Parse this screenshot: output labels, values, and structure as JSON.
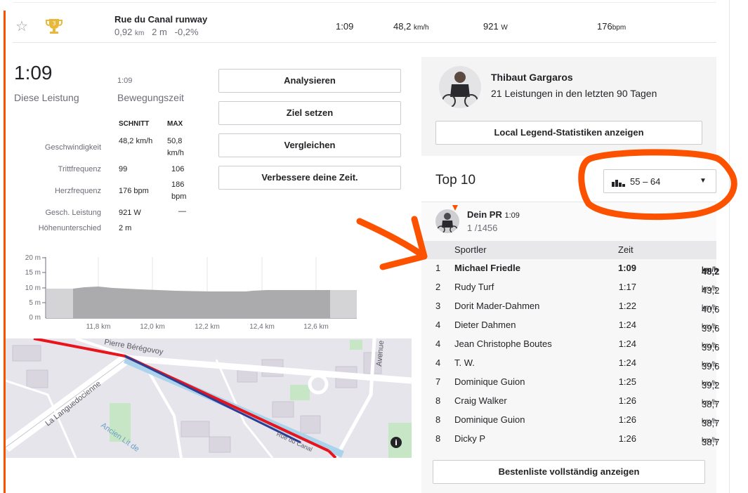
{
  "segment": {
    "name": "Rue du Canal runway",
    "distance": "0,92",
    "distance_unit": "km",
    "elev_gain": "2 m",
    "grade": "-0,2%",
    "time": "1:09",
    "speed": "48,2",
    "speed_unit": "km/h",
    "power": "921",
    "power_unit": "W",
    "hr": "176",
    "hr_unit": "bpm",
    "trophy_rank": "3"
  },
  "effort": {
    "time": "1:09",
    "time_label": "Diese Leistung",
    "moving_time": "1:09",
    "moving_label": "Bewegungszeit",
    "col_avg": "SCHNITT",
    "col_max": "MAX",
    "rows": [
      {
        "label": "Geschwindigkeit",
        "avg": "48,2 km/h",
        "max": "50,8 km/h"
      },
      {
        "label": "Trittfrequenz",
        "avg": "99",
        "max": "106"
      },
      {
        "label": "Herzfrequenz",
        "avg": "176 bpm",
        "max": "186 bpm"
      },
      {
        "label": "Gesch. Leistung",
        "avg": "921 W",
        "max": "—"
      },
      {
        "label": "Höhenunterschied",
        "avg": "2 m",
        "max": ""
      }
    ]
  },
  "actions": {
    "analyze": "Analysieren",
    "goal": "Ziel setzen",
    "compare": "Vergleichen",
    "improve": "Verbessere deine Zeit."
  },
  "elevation": {
    "y_ticks": [
      "20 m",
      "15 m",
      "10 m",
      "5 m",
      "0 m"
    ],
    "x_ticks": [
      "11,8 km",
      "12,0 km",
      "12,2 km",
      "12,4 km",
      "12,6 km"
    ]
  },
  "map": {
    "labels": [
      "Pierre Bérégovoy",
      "La Languedocienne",
      "Avenue",
      "Ancien Lit de",
      "Rue du Canal"
    ]
  },
  "athlete": {
    "name": "Thibaut Gargaros",
    "subtitle": "21 Leistungen in den letzten 90 Tagen",
    "local_legend_button": "Local Legend-Statistiken anzeigen"
  },
  "leaderboard": {
    "title": "Top 10",
    "filter_value": "55 – 64",
    "pr_label": "Dein PR",
    "pr_time": "1:09",
    "pr_rank": "1",
    "pr_total": "/1456",
    "col_athlete": "Sportler",
    "col_time": "Zeit",
    "rows": [
      {
        "rank": "1",
        "name": "Michael Friedle",
        "time": "1:09",
        "speed": "48,2",
        "unit": "km/h"
      },
      {
        "rank": "2",
        "name": "Rudy Turf",
        "time": "1:17",
        "speed": "43,2",
        "unit": "km/h"
      },
      {
        "rank": "3",
        "name": "Dorit Mader-Dahmen",
        "time": "1:22",
        "speed": "40,6",
        "unit": "km/h"
      },
      {
        "rank": "4",
        "name": "Dieter Dahmen",
        "time": "1:24",
        "speed": "39,6",
        "unit": "km/h"
      },
      {
        "rank": "4",
        "name": "Jean Christophe Boutes",
        "time": "1:24",
        "speed": "39,6",
        "unit": "km/h"
      },
      {
        "rank": "4",
        "name": "T. W.",
        "time": "1:24",
        "speed": "39,6",
        "unit": "km/h"
      },
      {
        "rank": "7",
        "name": "Dominique Guion",
        "time": "1:25",
        "speed": "39,2",
        "unit": "km/h"
      },
      {
        "rank": "8",
        "name": "Craig Walker",
        "time": "1:26",
        "speed": "38,7",
        "unit": "km/h"
      },
      {
        "rank": "8",
        "name": "Dominique Guion",
        "time": "1:26",
        "speed": "38,7",
        "unit": "km/h"
      },
      {
        "rank": "8",
        "name": "Dicky P",
        "time": "1:26",
        "speed": "38,7",
        "unit": "km/h"
      }
    ],
    "full_button": "Bestenliste vollständig anzeigen"
  },
  "colors": {
    "brand": "#fc5200",
    "annotation": "#fc5200"
  }
}
